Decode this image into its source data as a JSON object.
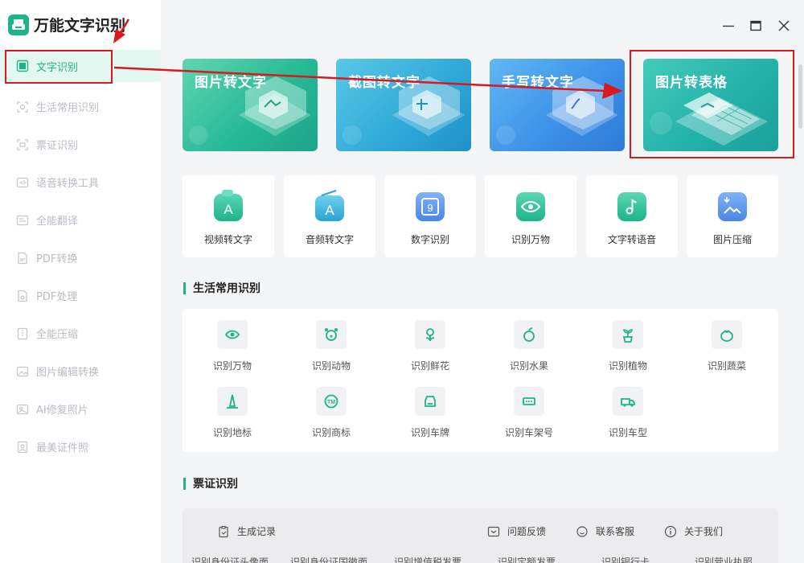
{
  "app": {
    "title": "万能文字识别"
  },
  "sidebar": {
    "items": [
      {
        "label": "文字识别",
        "icon": "scan-text-icon",
        "active": true
      },
      {
        "label": "生活常用识别",
        "icon": "life-scan-icon"
      },
      {
        "label": "票证识别",
        "icon": "ticket-scan-icon"
      },
      {
        "label": "语音转换工具",
        "icon": "voice-tool-icon"
      },
      {
        "label": "全能翻译",
        "icon": "translate-icon"
      },
      {
        "label": "PDF转换",
        "icon": "pdf-convert-icon"
      },
      {
        "label": "PDF处理",
        "icon": "pdf-process-icon"
      },
      {
        "label": "全能压缩",
        "icon": "compress-icon"
      },
      {
        "label": "图片编辑转换",
        "icon": "image-edit-icon"
      },
      {
        "label": "AI修复照片",
        "icon": "ai-repair-icon"
      },
      {
        "label": "最美证件照",
        "icon": "id-photo-icon"
      }
    ]
  },
  "banners": [
    {
      "title": "图片转文字"
    },
    {
      "title": "截图转文字"
    },
    {
      "title": "手写转文字"
    },
    {
      "title": "图片转表格"
    }
  ],
  "tools": [
    {
      "label": "视频转文字",
      "icon": "video-to-text-icon"
    },
    {
      "label": "音频转文字",
      "icon": "audio-to-text-icon"
    },
    {
      "label": "数字识别",
      "icon": "number-recognition-icon"
    },
    {
      "label": "识别万物",
      "icon": "eye-recognition-icon"
    },
    {
      "label": "文字转语音",
      "icon": "text-to-speech-icon"
    },
    {
      "label": "图片压缩",
      "icon": "image-compress-icon"
    }
  ],
  "life": {
    "title": "生活常用识别",
    "items": [
      {
        "label": "识别万物",
        "icon": "eye-icon"
      },
      {
        "label": "识别动物",
        "icon": "animal-icon"
      },
      {
        "label": "识别鲜花",
        "icon": "flower-icon"
      },
      {
        "label": "识别水果",
        "icon": "fruit-icon"
      },
      {
        "label": "识别植物",
        "icon": "plant-icon"
      },
      {
        "label": "识别蔬菜",
        "icon": "vegetable-icon"
      },
      {
        "label": "识别地标",
        "icon": "landmark-icon"
      },
      {
        "label": "识别商标",
        "icon": "trademark-icon"
      },
      {
        "label": "识别车牌",
        "icon": "license-plate-icon"
      },
      {
        "label": "识别车架号",
        "icon": "vin-icon"
      },
      {
        "label": "识别车型",
        "icon": "car-model-icon"
      }
    ]
  },
  "tickets": {
    "title": "票证识别",
    "cut_items": [
      "识别身份证头像面",
      "识别身份证国徽面",
      "识别增值税发票",
      "识别定额发票",
      "识别银行卡",
      "识别营业执照"
    ]
  },
  "bottom": {
    "history": "生成记录",
    "feedback": "问题反馈",
    "contact": "联系客服",
    "about": "关于我们"
  },
  "colors": {
    "accent": "#1db489",
    "highlight": "#d8191f"
  }
}
